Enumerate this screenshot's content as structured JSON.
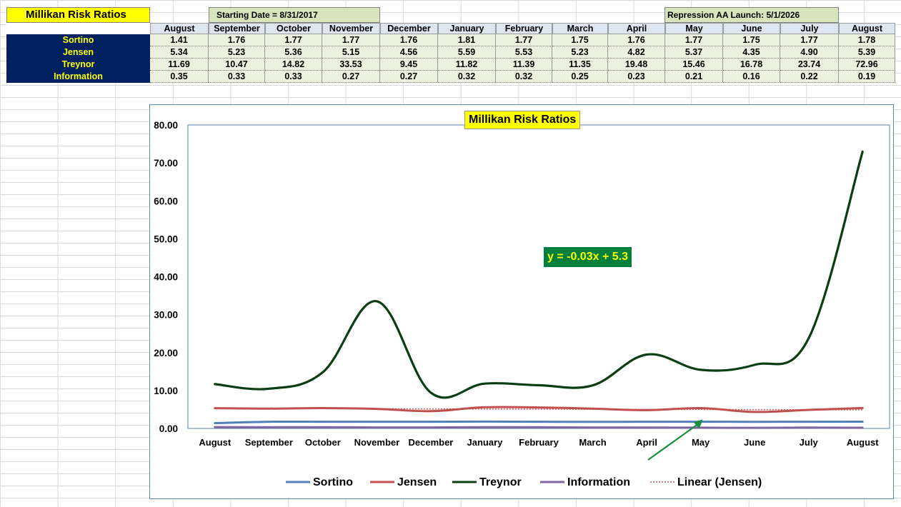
{
  "sheet": {
    "title": "Millikan Risk Ratios",
    "starting_date": "Starting Date = 8/31/2017",
    "repression_launch": "Repression AA Launch: 5/1/2026",
    "months": [
      "August",
      "September",
      "October",
      "November",
      "December",
      "January",
      "February",
      "March",
      "April",
      "May",
      "June",
      "July",
      "August"
    ],
    "rows": [
      {
        "label": "Sortino",
        "values": [
          "1.41",
          "1.76",
          "1.77",
          "1.77",
          "1.76",
          "1.81",
          "1.77",
          "1.75",
          "1.76",
          "1.77",
          "1.75",
          "1.77",
          "1.78"
        ]
      },
      {
        "label": "Jensen",
        "values": [
          "5.34",
          "5.23",
          "5.36",
          "5.15",
          "4.56",
          "5.59",
          "5.53",
          "5.23",
          "4.82",
          "5.37",
          "4.35",
          "4.90",
          "5.39"
        ]
      },
      {
        "label": "Treynor",
        "values": [
          "11.69",
          "10.47",
          "14.82",
          "33.53",
          "9.45",
          "11.82",
          "11.39",
          "11.35",
          "19.48",
          "15.46",
          "16.78",
          "23.74",
          "72.96"
        ]
      },
      {
        "label": "Information",
        "values": [
          "0.35",
          "0.33",
          "0.33",
          "0.27",
          "0.27",
          "0.32",
          "0.32",
          "0.25",
          "0.23",
          "0.21",
          "0.16",
          "0.22",
          "0.19"
        ]
      }
    ]
  },
  "chart_data": {
    "type": "line",
    "title": "Millikan Risk Ratios",
    "categories": [
      "August",
      "September",
      "October",
      "November",
      "December",
      "January",
      "February",
      "March",
      "April",
      "May",
      "June",
      "July",
      "August"
    ],
    "y_tick_labels": [
      "0.00",
      "10.00",
      "20.00",
      "30.00",
      "40.00",
      "50.00",
      "60.00",
      "70.00",
      "80.00"
    ],
    "ylim": [
      0,
      80
    ],
    "grid": false,
    "legend_position": "bottom",
    "series": [
      {
        "name": "Sortino",
        "color": "#4f81bd",
        "values": [
          1.41,
          1.76,
          1.77,
          1.77,
          1.76,
          1.81,
          1.77,
          1.75,
          1.76,
          1.77,
          1.75,
          1.77,
          1.78
        ]
      },
      {
        "name": "Jensen",
        "color": "#c0504d",
        "values": [
          5.34,
          5.23,
          5.36,
          5.15,
          4.56,
          5.59,
          5.53,
          5.23,
          4.82,
          5.37,
          4.35,
          4.9,
          5.39
        ]
      },
      {
        "name": "Treynor",
        "color": "#0b3d12",
        "values": [
          11.69,
          10.47,
          14.82,
          33.53,
          9.45,
          11.82,
          11.39,
          11.35,
          19.48,
          15.46,
          16.78,
          23.74,
          72.96
        ]
      },
      {
        "name": "Information",
        "color": "#8064a2",
        "values": [
          0.35,
          0.33,
          0.33,
          0.27,
          0.27,
          0.32,
          0.32,
          0.25,
          0.23,
          0.21,
          0.16,
          0.22,
          0.19
        ]
      }
    ],
    "trendline": {
      "name": "Linear (Jensen)",
      "color": "#c0504d",
      "slope": -0.03,
      "intercept": 5.3
    },
    "equation_label": "y = -0.03x + 5.3",
    "annotation": {
      "type": "arrow",
      "color": "#1a8f3c",
      "points_to": "May"
    }
  }
}
